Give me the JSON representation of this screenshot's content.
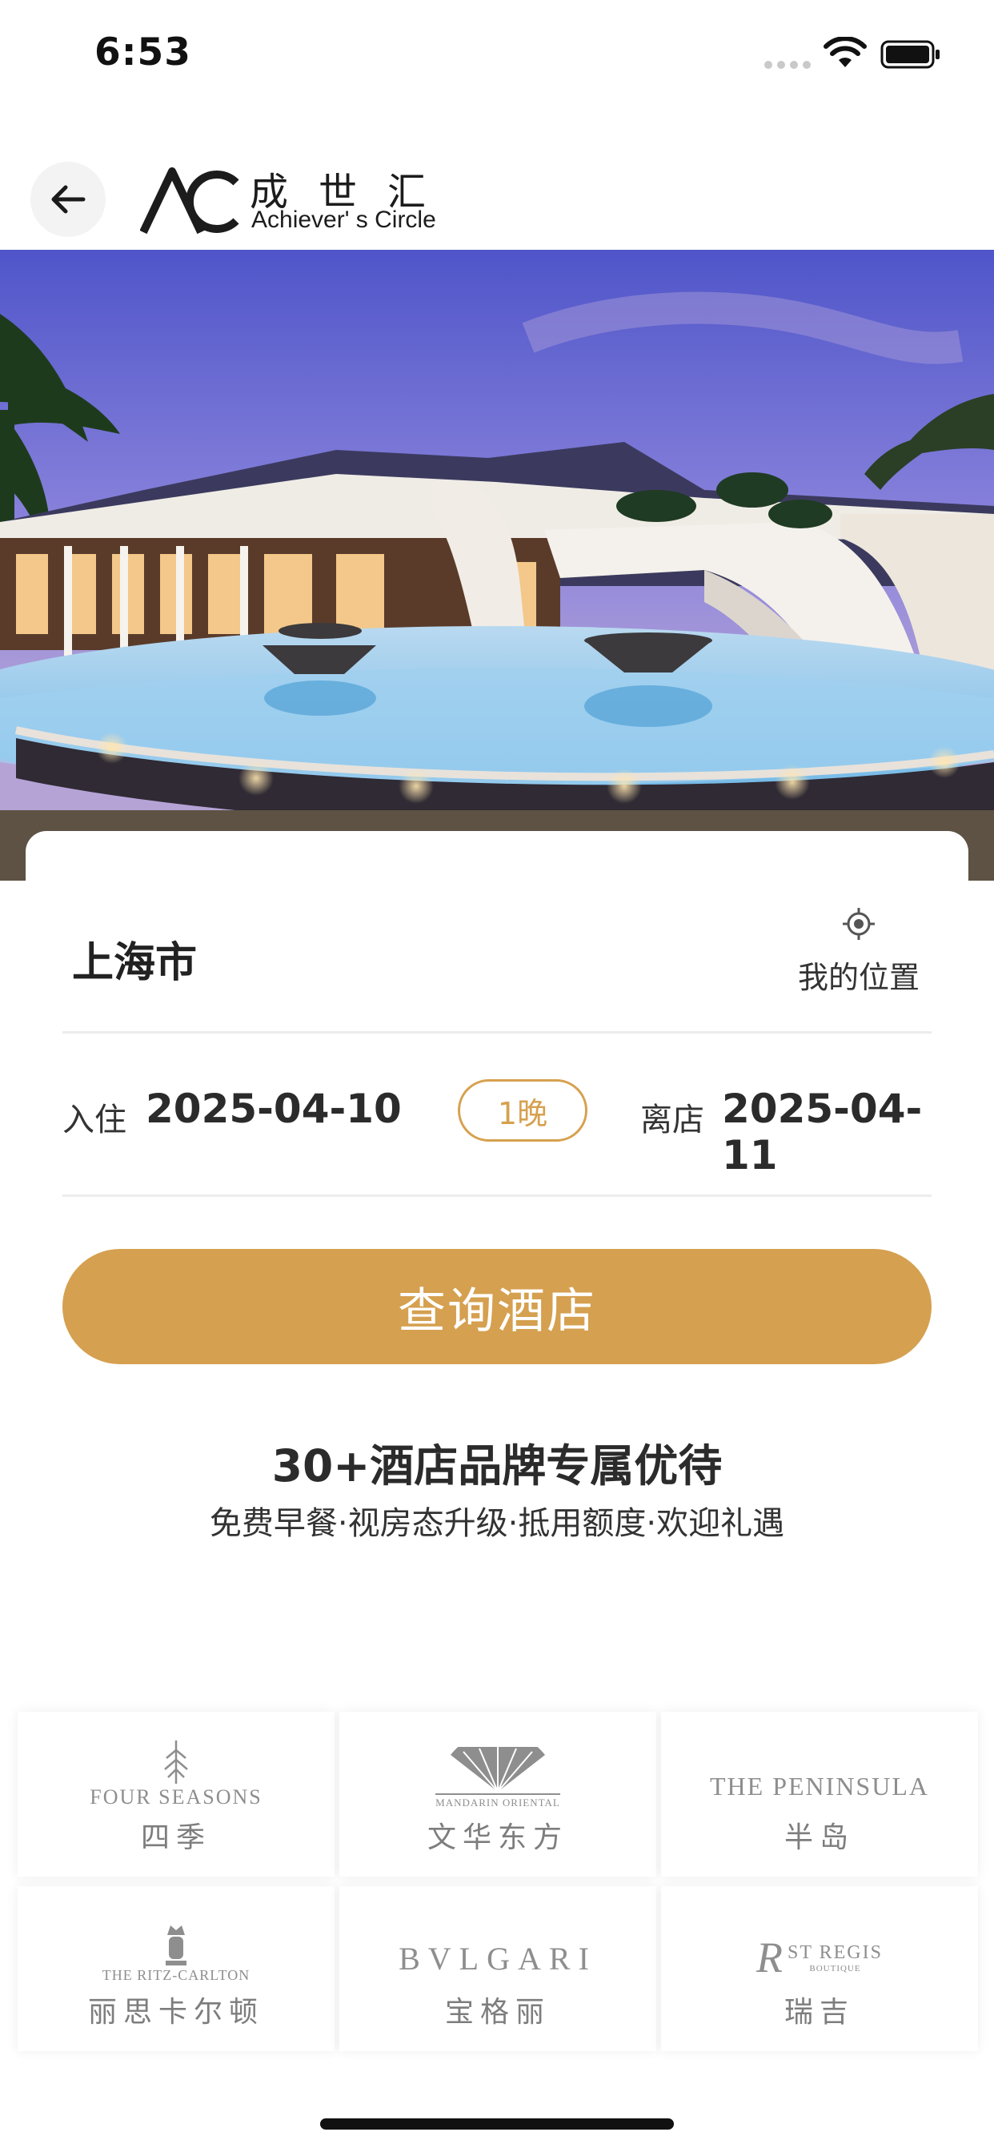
{
  "status_bar": {
    "time": "6:53"
  },
  "header": {
    "brand_cn": "成世汇",
    "brand_en": "Achiever' s Circle"
  },
  "search": {
    "city": "上海市",
    "locate_label": "我的位置",
    "checkin_label": "入住",
    "checkin_date": "2025-04-10",
    "nights": "1晚",
    "checkout_label": "离店",
    "checkout_date": "2025-04-11",
    "button_label": "查询酒店"
  },
  "promo": {
    "title": "30+酒店品牌专属优待",
    "subtitle": "免费早餐·视房态升级·抵用额度·欢迎礼遇"
  },
  "brands": [
    {
      "logo_text": "FOUR SEASONS",
      "name": "四季"
    },
    {
      "logo_text": "MANDARIN ORIENTAL",
      "name": "文华东方"
    },
    {
      "logo_text": "THE PENINSULA",
      "name": "半岛"
    },
    {
      "logo_text": "THE RITZ-CARLTON",
      "name": "丽思卡尔顿"
    },
    {
      "logo_text": "BVLGARI",
      "name": "宝格丽"
    },
    {
      "logo_text": "ST REGIS",
      "logo_subtext": "BOUTIQUE",
      "name": "瑞吉"
    }
  ],
  "colors": {
    "accent": "#d5a04f",
    "text": "#2b2b2b"
  }
}
